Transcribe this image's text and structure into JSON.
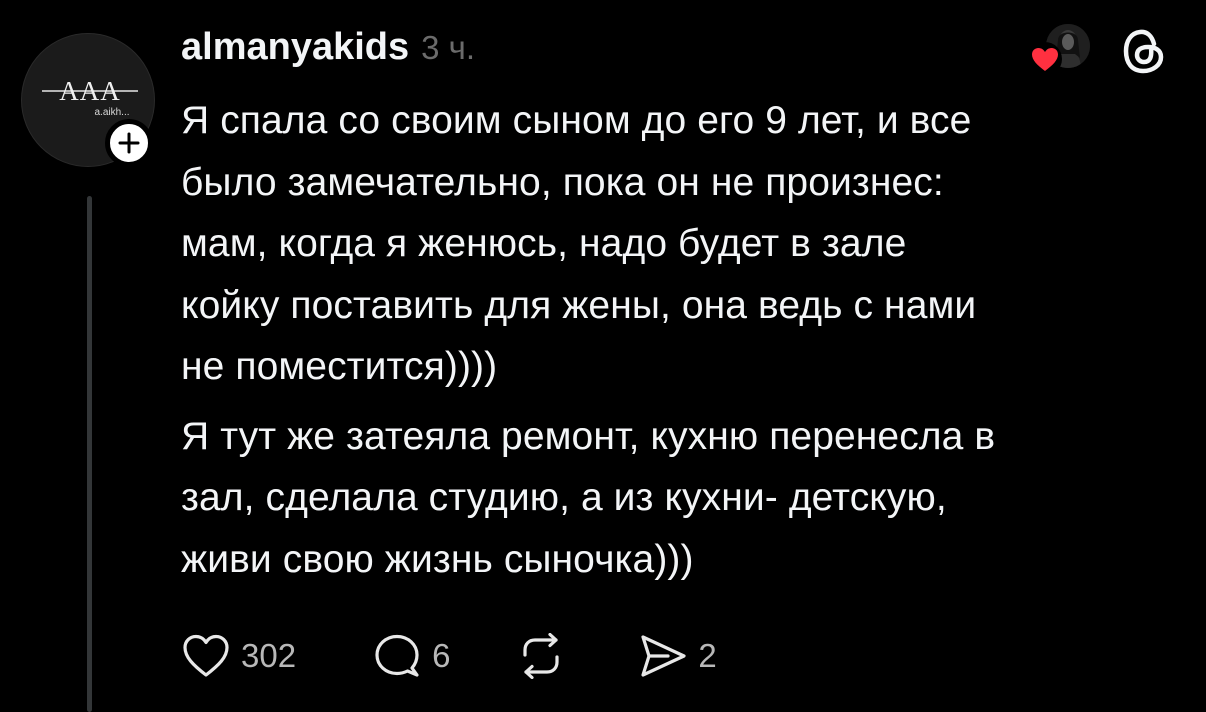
{
  "post": {
    "author": {
      "username": "almanyakids",
      "avatar_text": "AAA",
      "avatar_subtext": "a.aikh..."
    },
    "timestamp": "3 ч.",
    "paragraphs": [
      "Я спала со своим сыном до его 9 лет, и все\nбыло замечательно, пока он не произнес:\nмам, когда я женюсь, надо будет в зале\nкойку поставить для жены, она ведь с нами\nне поместится))))",
      "Я тут же затеяла ремонт, кухню перенесла в\nзал, сделала студию, а из кухни- детскую,\nживи свою жизнь сыночка)))"
    ],
    "actions": {
      "likes": "302",
      "replies": "6",
      "reposts": "",
      "shares": "2"
    }
  },
  "icons": {
    "follow": "plus-icon",
    "liked_by": "heart-icon",
    "app": "threads-logo-icon",
    "like": "heart-outline-icon",
    "reply": "speech-bubble-icon",
    "repost": "repost-icon",
    "share": "send-icon"
  },
  "colors": {
    "background": "#000000",
    "text": "#f3f5f7",
    "muted": "#6b6b6b",
    "heart": "#ff3040"
  }
}
